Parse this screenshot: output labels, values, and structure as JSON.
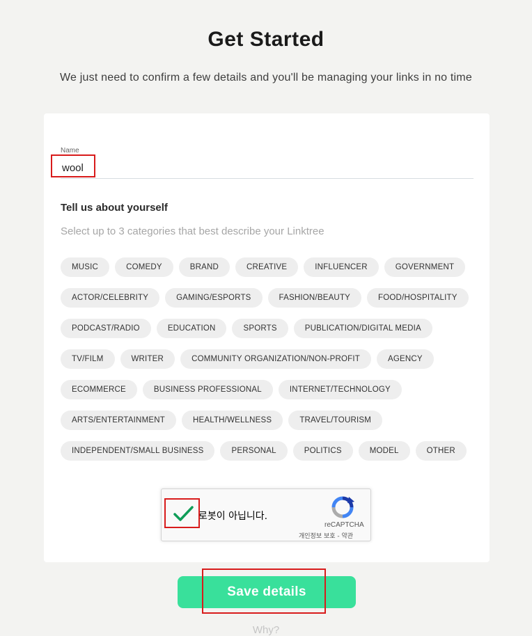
{
  "header": {
    "title": "Get Started",
    "subtitle": "We just need to confirm a few details and you'll be managing your links in no time"
  },
  "form": {
    "name_label": "Name",
    "name_value": "wool",
    "about_heading": "Tell us about yourself",
    "about_subheading": "Select up to 3 categories that best describe your Linktree",
    "categories": [
      "MUSIC",
      "COMEDY",
      "BRAND",
      "CREATIVE",
      "INFLUENCER",
      "GOVERNMENT",
      "ACTOR/CELEBRITY",
      "GAMING/ESPORTS",
      "FASHION/BEAUTY",
      "FOOD/HOSPITALITY",
      "PODCAST/RADIO",
      "EDUCATION",
      "SPORTS",
      "PUBLICATION/DIGITAL MEDIA",
      "TV/FILM",
      "WRITER",
      "COMMUNITY ORGANIZATION/NON-PROFIT",
      "AGENCY",
      "ECOMMERCE",
      "BUSINESS PROFESSIONAL",
      "INTERNET/TECHNOLOGY",
      "ARTS/ENTERTAINMENT",
      "HEALTH/WELLNESS",
      "TRAVEL/TOURISM",
      "INDEPENDENT/SMALL BUSINESS",
      "PERSONAL",
      "POLITICS",
      "MODEL",
      "OTHER"
    ]
  },
  "captcha": {
    "checked": true,
    "label": "로봇이 아닙니다.",
    "brand": "reCAPTCHA",
    "links": "개인정보 보호 - 약관",
    "check_color": "#0f9d58"
  },
  "actions": {
    "save_label": "Save details",
    "why_label": "Why?"
  },
  "colors": {
    "accent": "#39e09b",
    "highlight_box": "#d81b1b"
  }
}
